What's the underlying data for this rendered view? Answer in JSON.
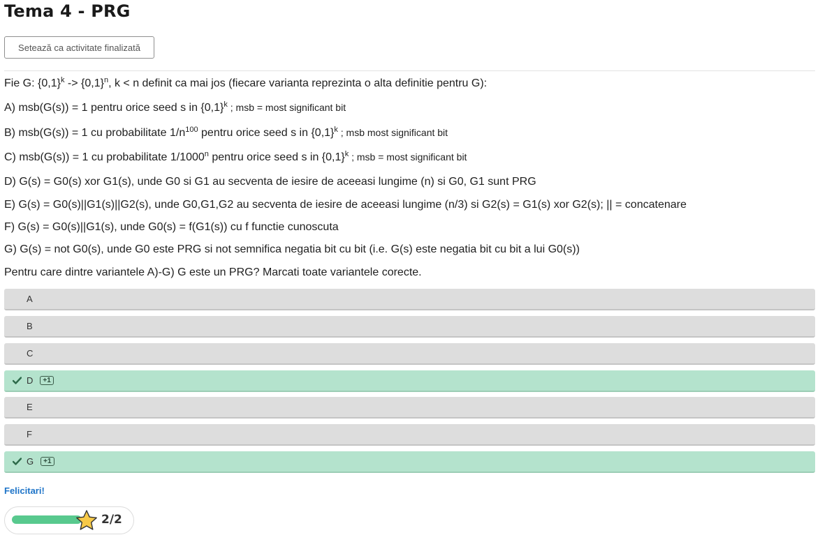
{
  "page": {
    "title": "Tema 4 - PRG"
  },
  "complete_button": {
    "label": "Setează ca activitate finalizată"
  },
  "question": {
    "intro": {
      "a": "Fie G: {0,1}",
      "b": "k",
      "c": " -> {0,1}",
      "d": "n",
      "e": ", k < n definit ca mai jos (fiecare varianta reprezinta o alta definitie pentru G):"
    },
    "line_a": {
      "a": "A) msb(G(s)) = 1 pentru orice seed s in {0,1}",
      "b": "k",
      "c": " ; msb = most significant bit"
    },
    "line_b": {
      "a": "B) msb(G(s)) = 1 cu probabilitate 1/n",
      "b": "100",
      "c": " pentru orice seed s in {0,1}",
      "d": "k",
      "e": " ; msb most significant bit"
    },
    "line_c": {
      "a": "C) msb(G(s)) = 1 cu probabilitate 1/1000",
      "b": "n",
      "c": " pentru orice seed s in {0,1}",
      "d": "k",
      "e": " ; msb = most significant bit"
    },
    "line_d": "D) G(s) = G0(s) xor G1(s), unde G0 si G1 au secventa de iesire de aceeasi lungime (n) si G0, G1 sunt PRG",
    "line_e": "E) G(s) = G0(s)||G1(s)||G2(s), unde G0,G1,G2 au secventa de iesire de aceeasi lungime (n/3) si G2(s) = G1(s) xor G2(s); || = concatenare",
    "line_f": "F) G(s) = G0(s)||G1(s), unde G0(s) = f(G1(s)) cu f functie cunoscuta",
    "line_g": "G) G(s) = not G0(s), unde G0 este PRG si not semnifica negatia bit cu bit (i.e. G(s) este negatia bit cu bit a lui G0(s))",
    "prompt": "Pentru care dintre variantele A)-G) G este un PRG? Marcati toate variantele corecte."
  },
  "options": [
    {
      "letter": "A",
      "correct": false
    },
    {
      "letter": "B",
      "correct": false
    },
    {
      "letter": "C",
      "correct": false
    },
    {
      "letter": "D",
      "correct": true,
      "badge": "+1"
    },
    {
      "letter": "E",
      "correct": false
    },
    {
      "letter": "F",
      "correct": false
    },
    {
      "letter": "G",
      "correct": true,
      "badge": "+1"
    }
  ],
  "feedback": "Felicitari!",
  "score": {
    "text": "2/2",
    "progress": 1.0,
    "icon": "star-icon",
    "bar_color": "#58c98e"
  },
  "colors": {
    "correct_bg": "#b4e3cd",
    "option_bg": "#dddddd",
    "feedback_text": "#1e74c8"
  }
}
